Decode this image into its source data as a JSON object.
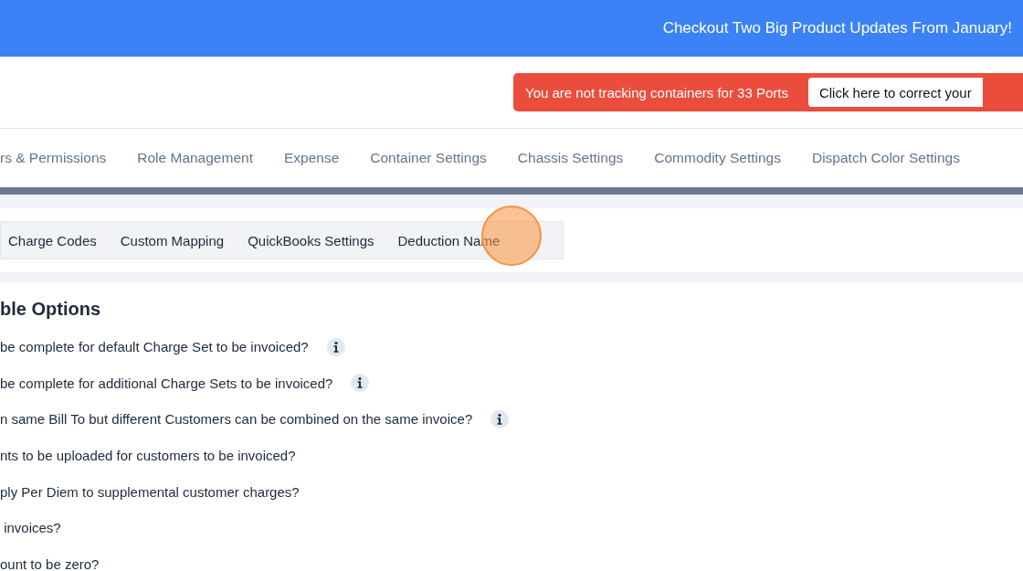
{
  "announcement": "Checkout Two Big Product Updates From January!",
  "alert": {
    "message": "You are not tracking containers for 33 Ports",
    "action": "Click here to correct your"
  },
  "tabs": [
    "rs & Permissions",
    "Role Management",
    "Expense",
    "Container Settings",
    "Chassis Settings",
    "Commodity Settings",
    "Dispatch Color Settings"
  ],
  "subtabs": [
    "Charge Codes",
    "Custom Mapping",
    "QuickBooks Settings",
    "Deduction Name"
  ],
  "section": {
    "title": "ble Options",
    "options": [
      {
        "text": "be complete for default Charge Set to be invoiced?",
        "info": true
      },
      {
        "text": "be complete for additional Charge Sets to be invoiced?",
        "info": true
      },
      {
        "text": "n same Bill To but different Customers can be combined on the same invoice?",
        "info": true
      },
      {
        "text": "nts to be uploaded for customers to be invoiced?",
        "info": false
      },
      {
        "text": "ply Per Diem to supplemental customer charges?",
        "info": false
      },
      {
        "text": " invoices?",
        "info": false
      },
      {
        "text": "ount to be zero?",
        "info": false
      }
    ]
  }
}
